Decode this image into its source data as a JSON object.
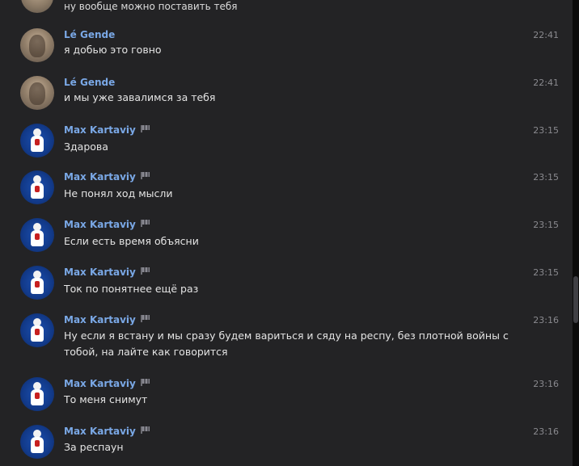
{
  "top_fragment": {
    "text": "ну вообще можно поставить тебя"
  },
  "messages": [
    {
      "author": "Lé Gende",
      "avatar": "le-gende-avatar",
      "time": "22:41",
      "text": "я добью это говно"
    },
    {
      "author": "Lé Gende",
      "avatar": "le-gende-avatar",
      "time": "22:41",
      "text": "и мы уже завалимся за тебя"
    },
    {
      "author": "Max Kartaviy",
      "avatar": "max-kartaviy-avatar",
      "time": "23:15",
      "text": "Здарова"
    },
    {
      "author": "Max Kartaviy",
      "avatar": "max-kartaviy-avatar",
      "time": "23:15",
      "text": "Не понял ход мысли"
    },
    {
      "author": "Max Kartaviy",
      "avatar": "max-kartaviy-avatar",
      "time": "23:15",
      "text": "Если есть время объясни"
    },
    {
      "author": "Max Kartaviy",
      "avatar": "max-kartaviy-avatar",
      "time": "23:15",
      "text": "Ток по понятнее ещё раз"
    },
    {
      "author": "Max Kartaviy",
      "avatar": "max-kartaviy-avatar",
      "time": "23:16",
      "text_line1": "Ну если я встану и мы сразу будем вариться и сяду на респу, без плотной войны с",
      "text_line2": "тобой, на лайте как говорится"
    },
    {
      "author": "Max Kartaviy",
      "avatar": "max-kartaviy-avatar",
      "time": "23:16",
      "text": "То меня снимут"
    },
    {
      "author": "Max Kartaviy",
      "avatar": "max-kartaviy-avatar",
      "time": "23:16",
      "text": "За респаун"
    }
  ],
  "colors": {
    "background": "#232325",
    "author": "#7aa8e6",
    "text": "#e4e4e4",
    "time": "#8a8a8f"
  },
  "icons": {
    "badge": "flag-badge-icon"
  }
}
